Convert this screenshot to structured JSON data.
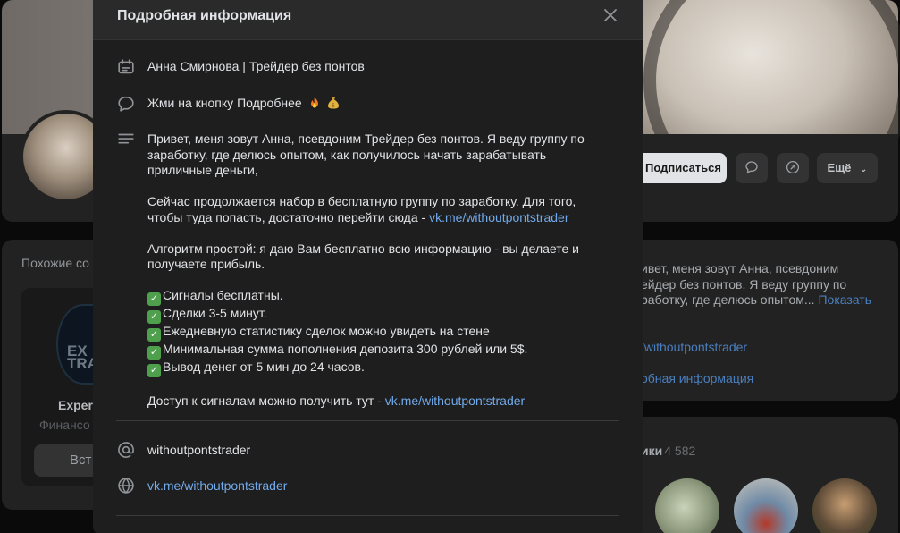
{
  "modal": {
    "title": "Подробная информация",
    "name": "Анна Смирнова | Трейдер без понтов",
    "status": "Жми на кнопку Подробнее",
    "description": {
      "p1": "Привет, меня зовут Анна, псевдоним Трейдер без понтов. Я веду группу по заработку, где делюсь опытом, как получилось начать зарабатывать приличные деньги,",
      "p2_text": "Сейчас продолжается набор в бесплатную группу по заработку. Для того, чтобы туда попасть, достаточно перейти сюда - ",
      "p2_link": "vk.me/withoutpontstrader",
      "p3": "Алгоритм простой: я даю Вам бесплатно всю информацию - вы делаете и получаете прибыль.",
      "checklist": [
        "Сигналы бесплатны.",
        "Сделки 3-5 минут.",
        "Ежедневную статистику сделок можно увидеть на стене",
        "Минимальная сумма пополнения депозита 300 рублей или 5$.",
        "Вывод денег от 5 мин до 24 часов."
      ],
      "p4_text": "Доступ к сигналам можно получить тут - ",
      "p4_link": "vk.me/withoutpontstrader"
    },
    "short_address": "withoutpontstrader",
    "website": "vk.me/withoutpontstrader"
  },
  "background": {
    "subscribe_label": "Подписаться",
    "more_label": "Ещё",
    "similar_title": "Похожие со",
    "rec_logo_text": "EX TRA",
    "rec_name": "Expert",
    "rec_sub": "Финансо",
    "rec_button": "Вст",
    "about_preview": "ивет, меня зовут Анна, псевдоним ейдер без понтов. Я веду группу по работку, где делюсь опытом... ",
    "show_more": "Показать",
    "link_preview": "/withoutpontstrader",
    "details_link": "обная информация",
    "followers_title": "ики",
    "followers_count": "4 582"
  },
  "colors": {
    "link": "#71aaeb",
    "modal_bg": "#1e1e1e",
    "header_bg": "#2a2a2a",
    "check": "#4ea04c"
  },
  "icons": {
    "name": "card-icon",
    "status": "message-bubble-icon",
    "description": "text-lines-icon",
    "address": "at-sign-icon",
    "website": "globe-icon",
    "close": "close-icon"
  }
}
